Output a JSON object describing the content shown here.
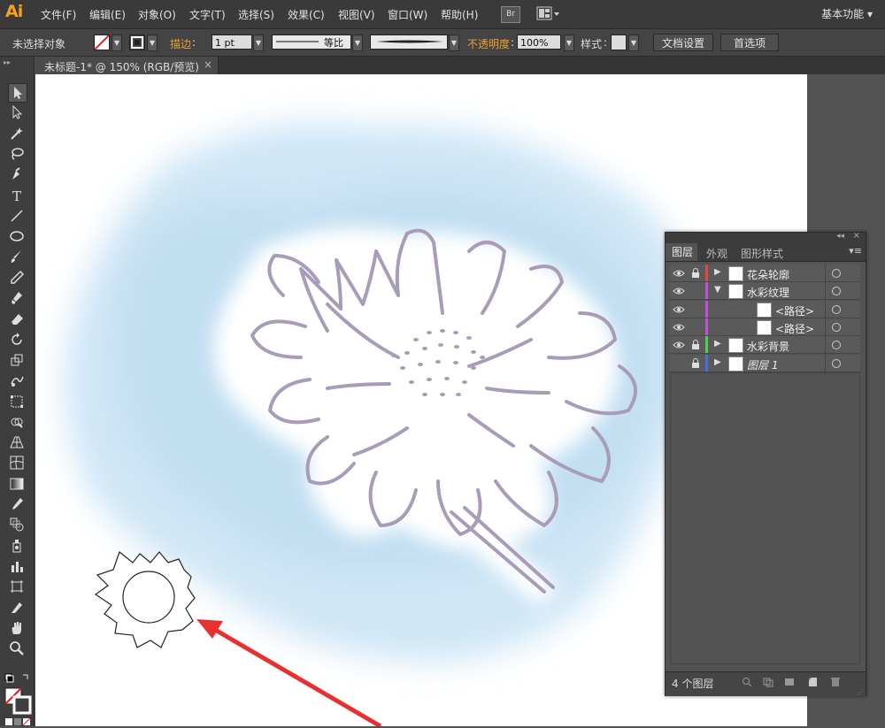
{
  "app": {
    "logo": "Ai"
  },
  "menu": {
    "items": [
      "文件(F)",
      "编辑(E)",
      "对象(O)",
      "文字(T)",
      "选择(S)",
      "效果(C)",
      "视图(V)",
      "窗口(W)",
      "帮助(H)"
    ],
    "bridge": "Br",
    "workspace": "基本功能"
  },
  "control": {
    "selection_status": "未选择对象",
    "stroke_label": "描边",
    "stroke_weight": "1 pt",
    "stroke_profile": "等比",
    "opacity_label": "不透明度",
    "opacity_value": "100%",
    "style_label": "样式",
    "doc_setup_button": "文档设置",
    "preferences_button": "首选项"
  },
  "document": {
    "tab_title": "未标题-1* @ 150% (RGB/预览)",
    "close_glyph": "×"
  },
  "tools": [
    "selection-tool",
    "direct-selection-tool",
    "magic-wand-tool",
    "lasso-tool",
    "pen-tool",
    "type-tool",
    "line-tool",
    "ellipse-tool",
    "paintbrush-tool",
    "pencil-tool",
    "blob-brush-tool",
    "eraser-tool",
    "rotate-tool",
    "scale-tool",
    "warp-tool",
    "free-transform-tool",
    "shape-builder-tool",
    "perspective-grid-tool",
    "mesh-tool",
    "gradient-tool",
    "eyedropper-tool",
    "blend-tool",
    "symbol-sprayer-tool",
    "column-graph-tool",
    "artboard-tool",
    "slice-tool",
    "hand-tool",
    "zoom-tool"
  ],
  "layers_panel": {
    "tabs": [
      "图层",
      "外观",
      "图形样式"
    ],
    "rows": [
      {
        "name": "花朵轮廓",
        "color": "#e04848",
        "visible": true,
        "locked": true,
        "expand": "closed",
        "indent": 0
      },
      {
        "name": "水彩纹理",
        "color": "#c050d8",
        "visible": true,
        "locked": false,
        "expand": "open",
        "indent": 0
      },
      {
        "name": "<路径>",
        "color": "#c050d8",
        "visible": true,
        "locked": false,
        "expand": "none",
        "indent": 1
      },
      {
        "name": "<路径>",
        "color": "#c050d8",
        "visible": true,
        "locked": false,
        "expand": "none",
        "indent": 1
      },
      {
        "name": "水彩背景",
        "color": "#50d050",
        "visible": true,
        "locked": true,
        "expand": "closed",
        "indent": 0
      },
      {
        "name": "图层 1",
        "color": "#4a6ee0",
        "visible": false,
        "locked": true,
        "expand": "closed",
        "indent": 0
      }
    ],
    "count": "4 个图层"
  },
  "colors": {
    "flower_stroke": "#a89cb8",
    "watercolor": "#cfe6f6",
    "annotation_arrow": "#e83030",
    "accent_orange": "#f0a030"
  }
}
